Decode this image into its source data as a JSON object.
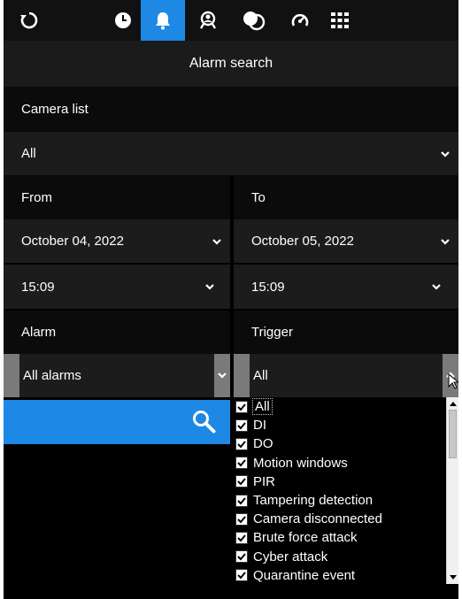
{
  "nav": {
    "items": [
      {
        "name": "back-icon"
      },
      {
        "name": "clock-icon"
      },
      {
        "name": "bell-icon"
      },
      {
        "name": "person-search-icon"
      },
      {
        "name": "overlap-circles-icon"
      },
      {
        "name": "gauge-icon"
      },
      {
        "name": "grid-icon"
      }
    ],
    "active_index": 2,
    "accent": "#1e88e5"
  },
  "title": "Alarm search",
  "camera": {
    "label": "Camera list",
    "selected": "All"
  },
  "from": {
    "label": "From",
    "date": "October 04, 2022",
    "time": "15:09"
  },
  "to": {
    "label": "To",
    "date": "October 05, 2022",
    "time": "15:09"
  },
  "alarm": {
    "label": "Alarm",
    "selected": "All alarms"
  },
  "trigger": {
    "label": "Trigger",
    "selected": "All",
    "options": [
      {
        "label": "All",
        "checked": true
      },
      {
        "label": "DI",
        "checked": true
      },
      {
        "label": "DO",
        "checked": true
      },
      {
        "label": "Motion windows",
        "checked": true
      },
      {
        "label": "PIR",
        "checked": true
      },
      {
        "label": "Tampering detection",
        "checked": true
      },
      {
        "label": "Camera disconnected",
        "checked": true
      },
      {
        "label": "Brute force attack",
        "checked": true
      },
      {
        "label": "Cyber attack",
        "checked": true
      },
      {
        "label": "Quarantine event",
        "checked": true
      }
    ]
  }
}
